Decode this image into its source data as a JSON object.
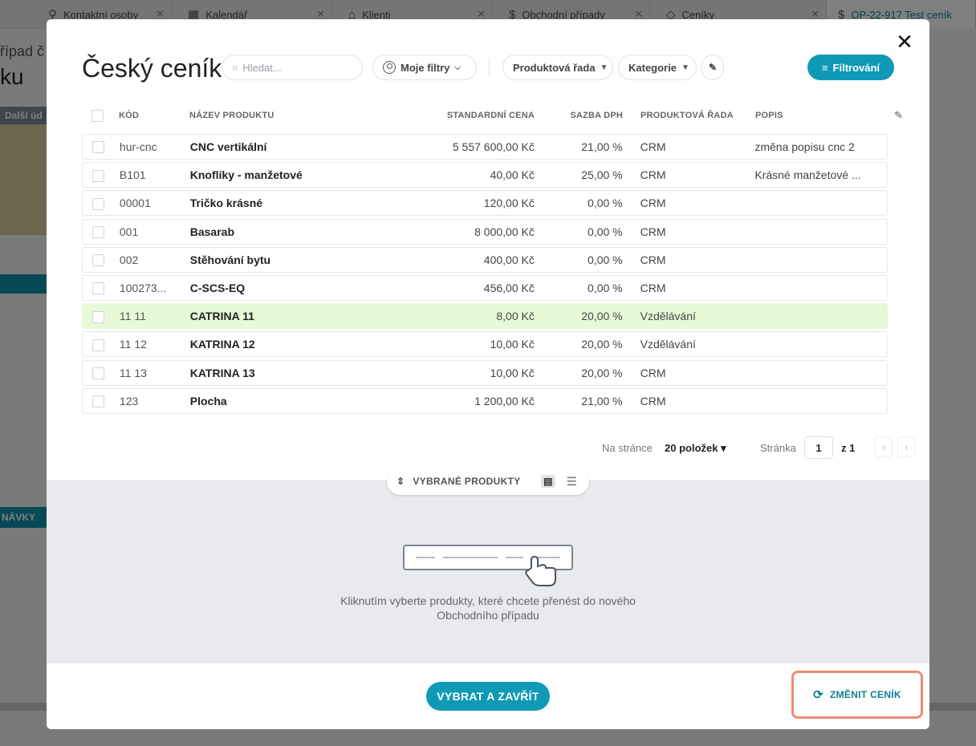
{
  "background": {
    "tabs": [
      {
        "icon": "person-icon",
        "glyph": "⚲",
        "label": "Kontaktní osoby"
      },
      {
        "icon": "calendar-icon",
        "glyph": "▦",
        "label": "Kalendář"
      },
      {
        "icon": "home-icon",
        "glyph": "⌂",
        "label": "Klienti"
      },
      {
        "icon": "dollar-icon",
        "glyph": "$",
        "label": "Obchodní případy"
      },
      {
        "icon": "tag-icon",
        "glyph": "◇",
        "label": "Ceníky"
      },
      {
        "icon": "dollar-icon",
        "glyph": "$",
        "label": "OP-22-917 Test ceník"
      }
    ],
    "title_line1": "řípad č",
    "title_line2": "ku",
    "strip_label": "Další úd",
    "strip2_label": "NÁVKY"
  },
  "modal": {
    "title": "Český ceník",
    "close_glyph": "✕",
    "search": {
      "placeholder": "Hledat..."
    },
    "my_filters": "Moje filtry",
    "product_line_filter": "Produktová řada",
    "category_filter": "Kategorie",
    "edit_glyph": "✎",
    "filter_button": "Filtrování",
    "filter_glyph": "≡",
    "columns": {
      "code": "KÓD",
      "name": "NÁZEV PRODUKTU",
      "price": "STANDARDNÍ CENA",
      "vat": "SAZBA DPH",
      "line": "PRODUKTOVÁ ŘADA",
      "desc": "POPIS"
    },
    "rows": [
      {
        "code": "hur-cnc",
        "name": "CNC vertikální",
        "price": "5 557 600,00 Kč",
        "vat": "21,00 %",
        "line": "CRM",
        "desc": "změna popisu cnc 2"
      },
      {
        "code": "B101",
        "name": "Knoflíky - manžetové",
        "price": "40,00 Kč",
        "vat": "25,00 %",
        "line": "CRM",
        "desc": "Krásné manžetové ..."
      },
      {
        "code": "00001",
        "name": "Tričko krásné",
        "price": "120,00 Kč",
        "vat": "0,00 %",
        "line": "CRM",
        "desc": ""
      },
      {
        "code": "001",
        "name": "Basarab",
        "price": "8 000,00 Kč",
        "vat": "0,00 %",
        "line": "CRM",
        "desc": ""
      },
      {
        "code": "002",
        "name": "Stěhování bytu",
        "price": "400,00 Kč",
        "vat": "0,00 %",
        "line": "CRM",
        "desc": ""
      },
      {
        "code": "100273...",
        "name": "C-SCS-EQ",
        "price": "456,00 Kč",
        "vat": "0,00 %",
        "line": "CRM",
        "desc": ""
      },
      {
        "code": "11 11",
        "name": "CATRINA 11",
        "price": "8,00 Kč",
        "vat": "20,00 %",
        "line": "Vzdělávání",
        "desc": ""
      },
      {
        "code": "11 12",
        "name": "KATRINA 12",
        "price": "10,00 Kč",
        "vat": "20,00 %",
        "line": "Vzdělávání",
        "desc": ""
      },
      {
        "code": "11 13",
        "name": "KATRINA 13",
        "price": "10,00 Kč",
        "vat": "20,00 %",
        "line": "CRM",
        "desc": ""
      },
      {
        "code": "123",
        "name": "Plocha",
        "price": "1 200,00 Kč",
        "vat": "21,00 %",
        "line": "CRM",
        "desc": ""
      }
    ],
    "highlighted_row": 6,
    "pager": {
      "per_page_label": "Na stránce",
      "per_page_value": "20 položek",
      "page_label": "Stránka",
      "page_value": "1",
      "of_label": "z 1",
      "prev_glyph": "‹",
      "next_glyph": "›"
    },
    "selected": {
      "label": "VYBRANÉ PRODUKTY",
      "empty_text": "Kliknutím vyberte produkty, které chcete přenést do nového Obchodního případu"
    },
    "footer": {
      "select_close": "VYBRAT A ZAVŘÍT",
      "change_pricelist": "ZMĚNIT CENÍK"
    }
  },
  "colors": {
    "accent": "#0e9ab6",
    "highlight_row": "#e6fad8",
    "change_border": "#ef8a73"
  }
}
